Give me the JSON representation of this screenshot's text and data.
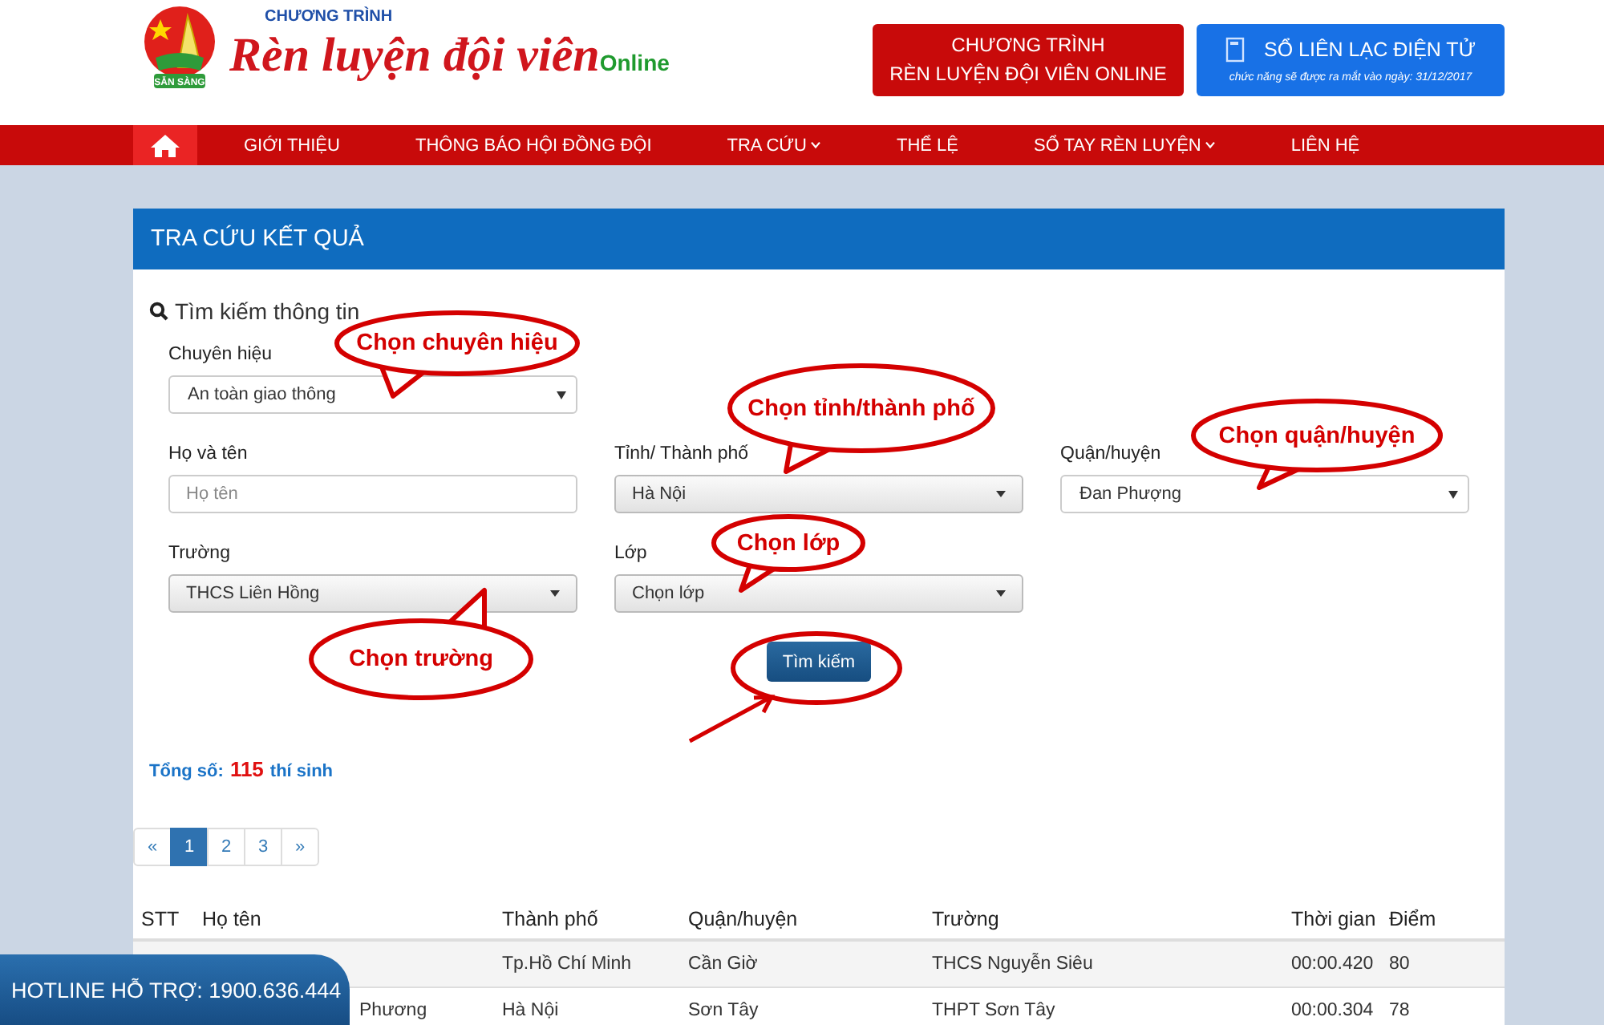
{
  "header": {
    "logo": {
      "ribbon": "SẴN SÀNG",
      "top": "CHƯƠNG TRÌNH",
      "main": "Rèn luyện đội viên",
      "suffix": "Online"
    },
    "program_button": {
      "lines": [
        "CHƯƠNG TRÌNH",
        "RÈN LUYỆN ĐỘI VIÊN ONLINE"
      ]
    },
    "contact_book_button": {
      "title": "SỔ LIÊN LẠC ĐIỆN TỬ",
      "note": "chức năng sẽ được ra mắt vào ngày: 31/12/2017"
    }
  },
  "nav": {
    "home_selected": true,
    "items": [
      {
        "label": "GIỚI THIỆU",
        "dropdown": false
      },
      {
        "label": "THÔNG BÁO HỘI ĐỒNG ĐỘI",
        "dropdown": false
      },
      {
        "label": "TRA CỨU",
        "dropdown": true
      },
      {
        "label": "THỂ LỆ",
        "dropdown": false
      },
      {
        "label": "SỔ TAY RÈN LUYỆN",
        "dropdown": true
      },
      {
        "label": "LIÊN HỆ",
        "dropdown": false
      }
    ]
  },
  "panel": {
    "title": "TRA CỨU KẾT QUẢ",
    "search_heading": "Tìm kiếm thông tin",
    "form_rows": [
      [
        {
          "label": "Chuyên hiệu",
          "kind": "plain-select",
          "value": "An toàn giao thông"
        }
      ],
      [
        {
          "label": "Họ và tên",
          "kind": "text",
          "placeholder": "Họ tên"
        },
        {
          "label": "Tỉnh/ Thành phố",
          "kind": "shaded-select",
          "value": "Hà Nội"
        },
        {
          "label": "Quận/huyện",
          "kind": "plain-select",
          "value": "Đan Phượng"
        }
      ],
      [
        {
          "label": "Trường",
          "kind": "shaded-select",
          "value": "THCS Liên Hồng"
        },
        {
          "label": "Lớp",
          "kind": "shaded-select",
          "value": "Chọn lớp"
        }
      ]
    ],
    "search_button": "Tìm kiếm",
    "callouts": [
      "Chọn chuyên hiệu",
      "Chọn tỉnh/thành phố",
      "Chọn quận/huyện",
      "Chọn lớp",
      "Chọn trường"
    ],
    "total": {
      "label": "Tổng số:",
      "count": "115",
      "unit": "thí sinh"
    },
    "pagination": [
      {
        "label": "«",
        "selected": false
      },
      {
        "label": "1",
        "selected": true
      },
      {
        "label": "2",
        "selected": false
      },
      {
        "label": "3",
        "selected": false
      },
      {
        "label": "»",
        "selected": false
      }
    ],
    "table": {
      "columns": [
        "STT",
        "Họ tên",
        "Thành phố",
        "Quận/huyện",
        "Trường",
        "Thời gian",
        "Điểm"
      ],
      "rows": [
        {
          "city": "Tp.Hồ Chí Minh",
          "district": "Cần Giờ",
          "school": "THCS Nguyễn Siêu",
          "time": "00:00.420",
          "score": "80"
        },
        {
          "name": "Phương",
          "city": "Hà Nội",
          "district": "Sơn Tây",
          "school": "THPT Sơn Tây",
          "time": "00:00.304",
          "score": "78"
        }
      ]
    }
  },
  "hotline": "HOTLINE HỖ TRỢ: 1900.636.444"
}
